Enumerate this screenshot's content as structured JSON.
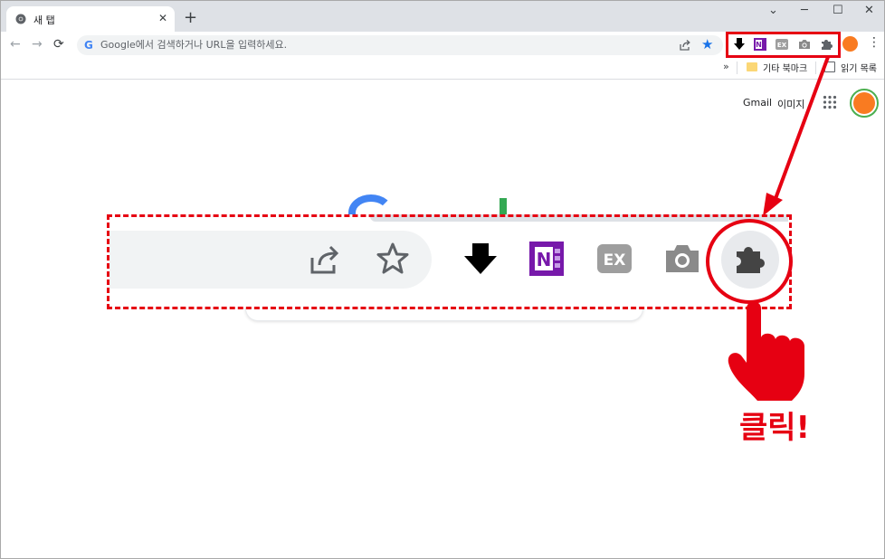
{
  "tab": {
    "title": "새 탭",
    "favicon": "chrome-icon"
  },
  "tabstrip": {
    "new_tab_label": "+",
    "minimize": "─",
    "maximize": "☐",
    "close": "✕",
    "dropdown": "⌄"
  },
  "toolbar": {
    "back": "←",
    "forward": "→",
    "reload": "⟳",
    "address_placeholder": "Google에서 검색하거나 URL을 입력하세요.",
    "menu": "⋮"
  },
  "extensions": [
    "download-ext-icon",
    "onenote-ext-icon",
    "ex-ext-icon",
    "camera-ext-icon",
    "puzzle-extensions-icon"
  ],
  "bookmarks": {
    "more": "»",
    "other": "기타 북마크",
    "reading": "읽기 목록"
  },
  "page": {
    "gmail": "Gmail",
    "images": "이미지"
  },
  "annotation": {
    "click_text": "클릭!"
  },
  "colors": {
    "accent_red": "#e60012",
    "chrome_blue": "#1a73e8",
    "avatar_orange": "#f97b21",
    "onenote_purple": "#7719aa"
  }
}
